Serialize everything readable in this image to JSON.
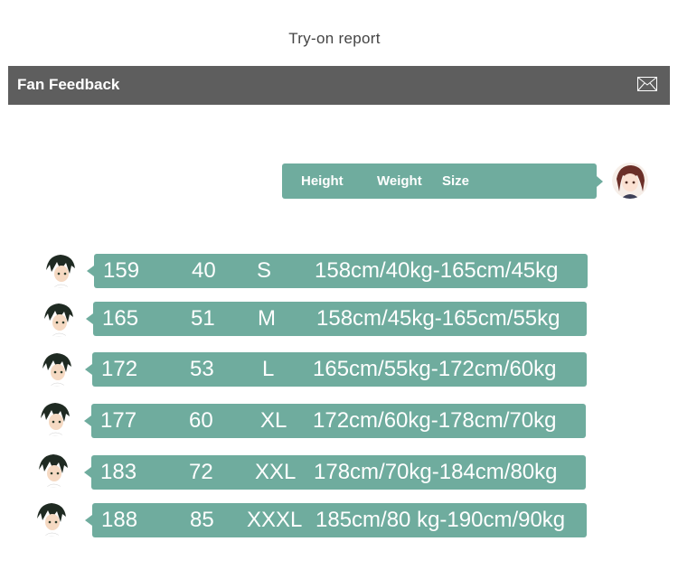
{
  "page_title": "Try-on report",
  "feedback_bar": {
    "title": "Fan Feedback",
    "icon": "mail-icon"
  },
  "header": {
    "height_label": "Height",
    "weight_label": "Weight",
    "size_label": "Size"
  },
  "rows": [
    {
      "height": "159",
      "weight": "40",
      "size": "S",
      "range": "158cm/40kg-165cm/45kg"
    },
    {
      "height": "165",
      "weight": "51",
      "size": "M",
      "range": "158cm/45kg-165cm/55kg"
    },
    {
      "height": "172",
      "weight": "53",
      "size": "L",
      "range": "165cm/55kg-172cm/60kg"
    },
    {
      "height": "177",
      "weight": "60",
      "size": "XL",
      "range": "172cm/60kg-178cm/70kg"
    },
    {
      "height": "183",
      "weight": "72",
      "size": "XXL",
      "range": "178cm/70kg-184cm/80kg"
    },
    {
      "height": "188",
      "weight": "85",
      "size": "XXXL",
      "range": "185cm/80 kg-190cm/90kg"
    }
  ],
  "colors": {
    "bubble": "#6fac9e",
    "bar": "#5e5e5e",
    "text": "#ffffff"
  }
}
